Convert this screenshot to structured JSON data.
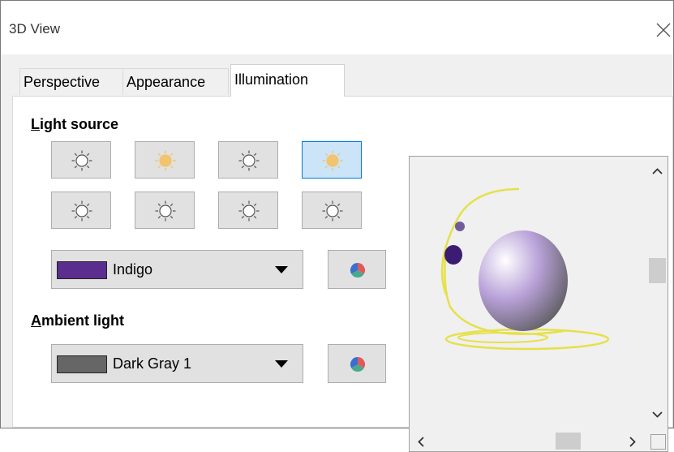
{
  "window": {
    "title": "3D View"
  },
  "tabs": [
    {
      "label": "Perspective",
      "active": false
    },
    {
      "label": "Appearance",
      "active": false
    },
    {
      "label": "Illumination",
      "active": true
    }
  ],
  "light_source": {
    "heading_first": "L",
    "heading_rest": "ight source",
    "buttons_on": [
      false,
      true,
      false,
      true,
      false,
      false,
      false,
      false
    ],
    "selected_index": 3,
    "color_name": "Indigo",
    "color_hex": "#5b2d8e"
  },
  "ambient_light": {
    "heading_first": "A",
    "heading_rest": "mbient light",
    "color_name": "Dark Gray 1",
    "color_hex": "#666666"
  },
  "colors": {
    "bulb_on": "#f2c46d",
    "bulb_off": "#ffffff",
    "selected_border": "#0078d7",
    "sphere_light": "#ffffff",
    "sphere_mid": "#b9a2d9",
    "sphere_dark": "#555555",
    "lamp_wire": "#e6e04a",
    "preview_light_sphere": "#3b1c73"
  },
  "icons": {
    "close": "close-icon",
    "bulb": "light-bulb-icon",
    "picker": "color-picker-icon",
    "scroll_up": "chevron-up-icon",
    "scroll_down": "chevron-down-icon",
    "scroll_left": "chevron-left-icon",
    "scroll_right": "chevron-right-icon"
  }
}
